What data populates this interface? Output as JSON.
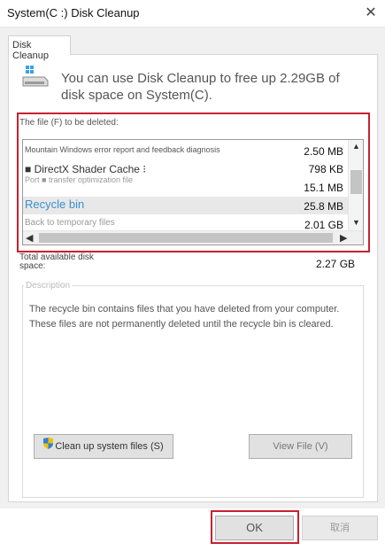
{
  "window": {
    "title": "System(C :) Disk Cleanup",
    "close_glyph": "✕"
  },
  "tab": {
    "label": "Disk Cleanup"
  },
  "header": {
    "icon": "disk-cleanup-icon",
    "message": "You can use Disk Cleanup to free up 2.29GB of disk space on System(C)."
  },
  "files": {
    "label": "The file (F) to be deleted:",
    "items": [
      {
        "name": "Mountain Windows error report and feedback diagnosis",
        "size": "2.50 MB"
      },
      {
        "name": "■ DirectX Shader Cache  ⁝",
        "size": "798 KB"
      },
      {
        "name": "Port ■ transfer optimization file",
        "size": "15.1 MB"
      },
      {
        "name": "Recycle bin",
        "size": "25.8 MB",
        "selected": true
      },
      {
        "name": "Back to temporary files",
        "size": "2.01 GB"
      }
    ]
  },
  "total": {
    "label": "Total available disk space:",
    "value": "2.27 GB"
  },
  "description": {
    "legend": "Description",
    "text": "The recycle bin contains files that you have deleted from your computer. These files are not permanently deleted until the recycle bin is cleared."
  },
  "buttons": {
    "clean_system": "Clean up system files (S)",
    "view_file": "View File (V)",
    "ok": "OK",
    "cancel": "取消"
  },
  "colors": {
    "highlight_red": "#c8202f",
    "recycle_blue": "#3b8fd0"
  }
}
